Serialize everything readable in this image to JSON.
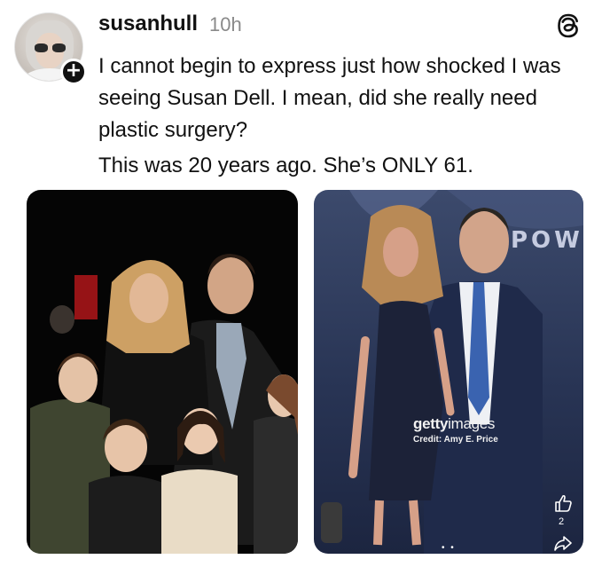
{
  "post": {
    "username": "susanhull",
    "time": "10h",
    "paragraph_1": "I cannot begin to express just how shocked I was seeing Susan Dell.  I mean, did she really need plastic surgery?",
    "paragraph_2": "This was 20 years ago.  She’s ONLY 61.",
    "follow_symbol": "+"
  },
  "images": {
    "right": {
      "background_text": "POWE",
      "watermark_brand_bold": "getty",
      "watermark_brand_light": "images",
      "watermark_credit": "Credit: Amy E. Price",
      "like_count": "2"
    }
  },
  "icons": {
    "app_logo": "threads-logo-icon",
    "follow": "plus-icon",
    "like": "thumbs-up-icon",
    "share": "share-icon"
  },
  "colors": {
    "text": "#111111",
    "muted": "#8a8a8a",
    "left_photo_bg": "#050505",
    "right_photo_bg": "#2c3858"
  }
}
